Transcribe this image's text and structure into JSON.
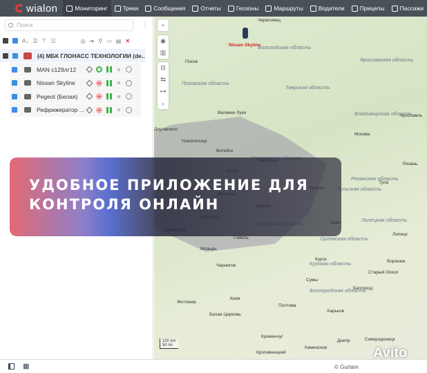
{
  "app": {
    "logo": "wialon"
  },
  "nav": [
    {
      "label": "Мониторинг",
      "active": true
    },
    {
      "label": "Треки"
    },
    {
      "label": "Сообщения"
    },
    {
      "label": "Отчеты"
    },
    {
      "label": "Геозоны"
    },
    {
      "label": "Маршруты"
    },
    {
      "label": "Водители"
    },
    {
      "label": "Прицепы"
    },
    {
      "label": "Пассажи"
    }
  ],
  "search": {
    "placeholder": "Поиск"
  },
  "group": {
    "name": "(4) МБК ГЛОНАСС ТЕХНОЛОГИИ (de..."
  },
  "units": [
    {
      "name": "MAN с129лг12",
      "status": "online"
    },
    {
      "name": "Nissan Skyline",
      "status": "offline"
    },
    {
      "name": "Pegeot (Белая)",
      "status": "offline"
    },
    {
      "name": "Рефрижератор ...",
      "status": "offline"
    }
  ],
  "map": {
    "marker_label": "Nissan Skyline",
    "cities": [
      "Череповец",
      "Псков",
      "Великие Луки",
      "Москва",
      "Витебск",
      "Новополоцк",
      "Орша",
      "Могилев",
      "Бобруйск",
      "Солигорск",
      "Мозырь",
      "Гомель",
      "Чернигов",
      "Брянск",
      "Орёл",
      "Липецк",
      "Курск",
      "Воронеж",
      "Старый Оскол",
      "Сумы",
      "Житомир",
      "Киев",
      "Белая Церковь",
      "Полтава",
      "Харьков",
      "Кременчуг",
      "Кропивницкий",
      "Каменское",
      "Днепр",
      "Северодонецк",
      "Тула",
      "Калуга",
      "Смоленск",
      "Белгород",
      "Ярославль",
      "Рязань",
      "Даугавпилс"
    ],
    "regions": [
      "Вологодская область",
      "Ярославская область",
      "Псковская область",
      "Тверская область",
      "Владимирская область",
      "Смоленская область",
      "Тульская область",
      "Рязанская область",
      "Брянская область",
      "Липецкая область",
      "Орловская область",
      "Курская область",
      "Белгородская область"
    ],
    "scale": {
      "km": "100 km",
      "mi": "50 mi"
    }
  },
  "banner": {
    "line1": "УДОБНОЕ ПРИЛОЖЕНИЕ ДЛЯ",
    "line2": "КОНТРОЛЯ ОНЛАЙН"
  },
  "footer": {
    "copyright": "© Gurtam"
  },
  "watermark": "Avito",
  "colors": {
    "topbar": "#4a5058",
    "accent": "#3a8ee6",
    "online": "#3fb24a",
    "logo": "#e23b3b"
  }
}
